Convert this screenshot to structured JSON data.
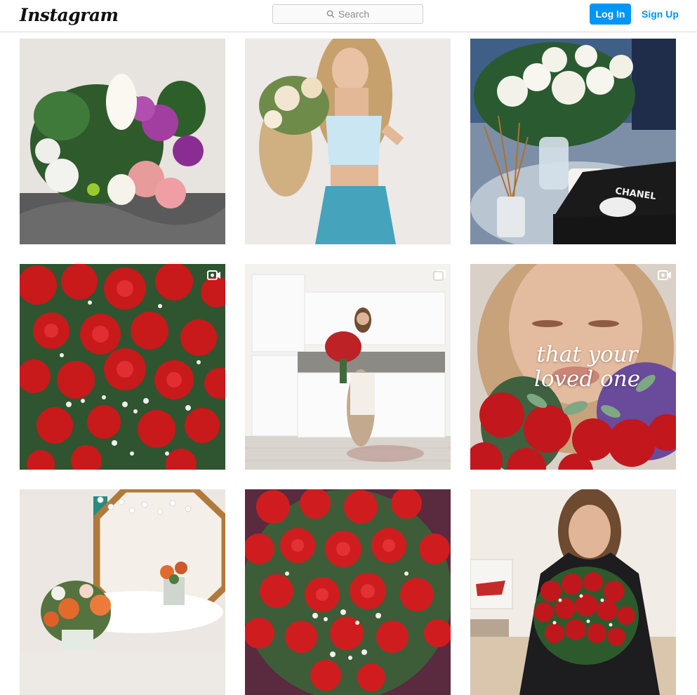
{
  "header": {
    "logo": "Instagram",
    "search_placeholder": "Search",
    "login_label": "Log In",
    "signup_label": "Sign Up"
  },
  "colors": {
    "accent": "#0095f6",
    "border": "#dbdbdb"
  },
  "posts": [
    {
      "subject": "mixed bouquet with calla lily, pink roses and purple daisies",
      "badge": null
    },
    {
      "subject": "smiling woman holding flowers in a straw bag",
      "badge": null
    },
    {
      "subject": "white roses with Chanel book, candle and reed diffuser",
      "badge": null
    },
    {
      "subject": "red roses with baby's breath",
      "badge": "video-icon"
    },
    {
      "subject": "woman holding red roses in white kitchen",
      "badge": "carousel-icon"
    },
    {
      "subject": "woman smelling red roses",
      "badge": "video-icon",
      "overlay_text": [
        "that your",
        "loved one"
      ]
    },
    {
      "subject": "orange roses in vase before octagonal mirror and chandelier",
      "badge": null
    },
    {
      "subject": "large bouquet of red roses",
      "badge": null
    },
    {
      "subject": "smiling woman holding bouquet of red roses",
      "badge": null
    }
  ]
}
